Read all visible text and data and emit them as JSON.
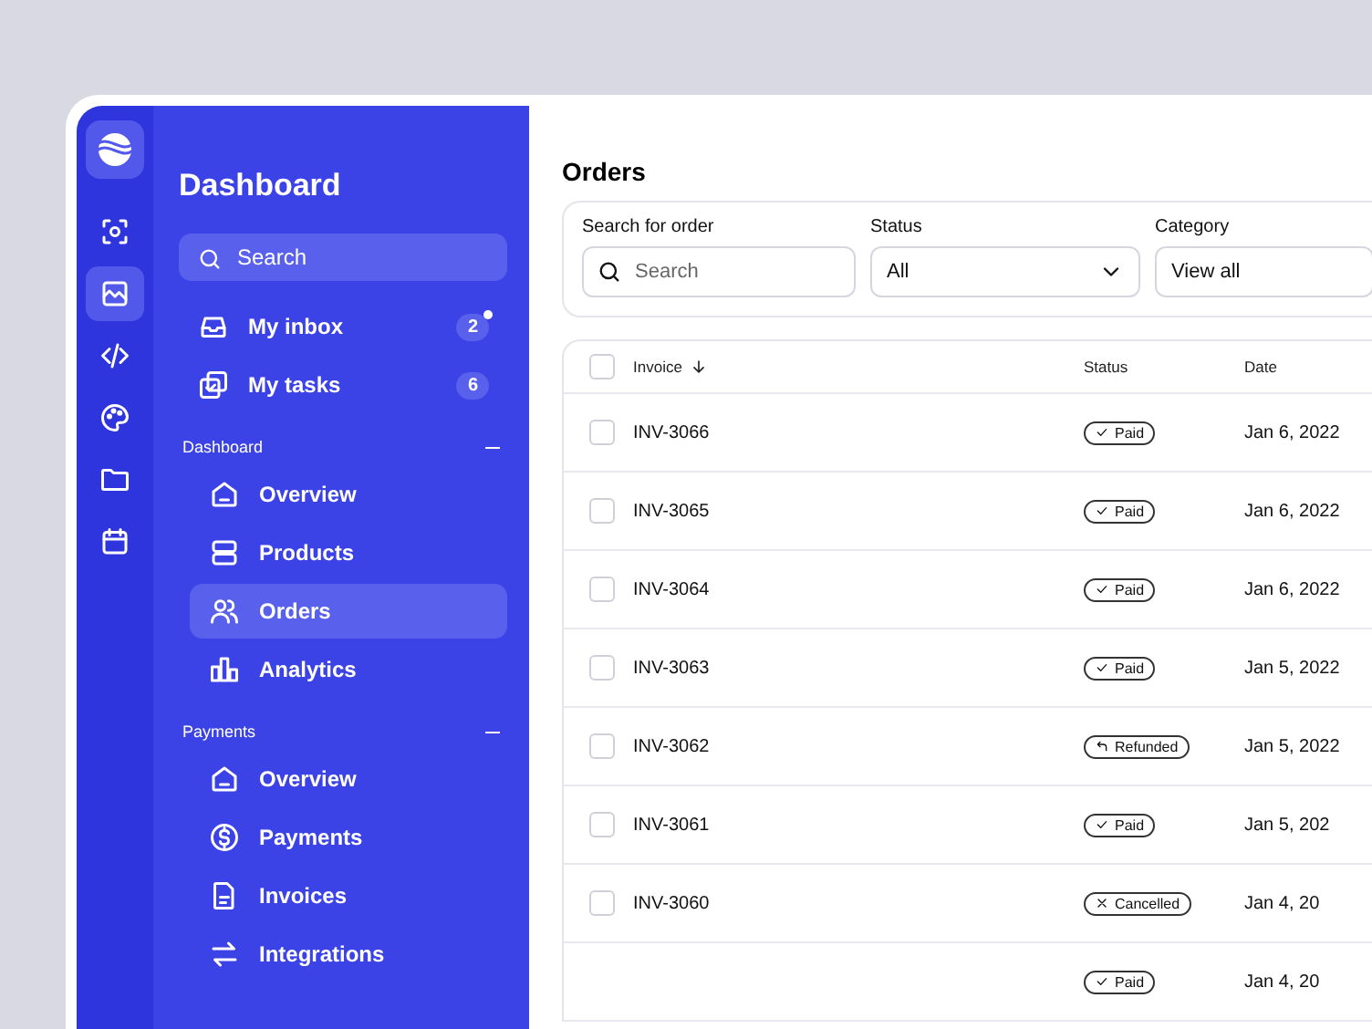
{
  "rail": {
    "items": [
      {
        "kind": "scan",
        "selected": false
      },
      {
        "kind": "chart",
        "selected": true
      },
      {
        "kind": "code",
        "selected": false
      },
      {
        "kind": "palette",
        "selected": false
      },
      {
        "kind": "folder",
        "selected": false
      },
      {
        "kind": "calendar",
        "selected": false
      }
    ]
  },
  "sidebar": {
    "title": "Dashboard",
    "search": {
      "placeholder": "Search"
    },
    "top_items": [
      {
        "kind": "inbox",
        "label": "My inbox",
        "count": "2",
        "unread": true
      },
      {
        "kind": "tasks",
        "label": "My tasks",
        "count": "6",
        "unread": false
      }
    ],
    "sections": [
      {
        "title": "Dashboard",
        "expanded": true,
        "items": [
          {
            "kind": "home",
            "label": "Overview",
            "selected": false
          },
          {
            "kind": "stack",
            "label": "Products",
            "selected": false
          },
          {
            "kind": "users",
            "label": "Orders",
            "selected": true
          },
          {
            "kind": "bars",
            "label": "Analytics",
            "selected": false
          }
        ]
      },
      {
        "title": "Payments",
        "expanded": true,
        "items": [
          {
            "kind": "home",
            "label": "Overview",
            "selected": false
          },
          {
            "kind": "dollar",
            "label": "Payments",
            "selected": false
          },
          {
            "kind": "file",
            "label": "Invoices",
            "selected": false
          },
          {
            "kind": "swap",
            "label": "Integrations",
            "selected": false
          }
        ]
      }
    ]
  },
  "main": {
    "title": "Orders",
    "filters": {
      "search": {
        "label": "Search for order",
        "placeholder": "Search"
      },
      "status": {
        "label": "Status",
        "value": "All"
      },
      "category": {
        "label": "Category",
        "value": "View all"
      }
    },
    "table": {
      "all_checked": false,
      "columns": [
        "Invoice",
        "Status",
        "Date"
      ],
      "rows": [
        {
          "invoice": "INV-3066",
          "status": "Paid",
          "kind": "paid",
          "date": "Jan 6, 2022",
          "checked": false
        },
        {
          "invoice": "INV-3065",
          "status": "Paid",
          "kind": "paid",
          "date": "Jan 6, 2022",
          "checked": false
        },
        {
          "invoice": "INV-3064",
          "status": "Paid",
          "kind": "paid",
          "date": "Jan 6, 2022",
          "checked": false
        },
        {
          "invoice": "INV-3063",
          "status": "Paid",
          "kind": "paid",
          "date": "Jan 5, 2022",
          "checked": false
        },
        {
          "invoice": "INV-3062",
          "status": "Refunded",
          "kind": "refunded",
          "date": "Jan 5, 2022",
          "checked": false
        },
        {
          "invoice": "INV-3061",
          "status": "Paid",
          "kind": "paid",
          "date": "Jan 5, 202",
          "checked": false
        },
        {
          "invoice": "INV-3060",
          "status": "Cancelled",
          "kind": "cancelled",
          "date": "Jan 4, 20",
          "checked": false
        },
        {
          "status": "Paid",
          "kind": "paid",
          "date": "Jan 4, 20"
        }
      ]
    }
  }
}
